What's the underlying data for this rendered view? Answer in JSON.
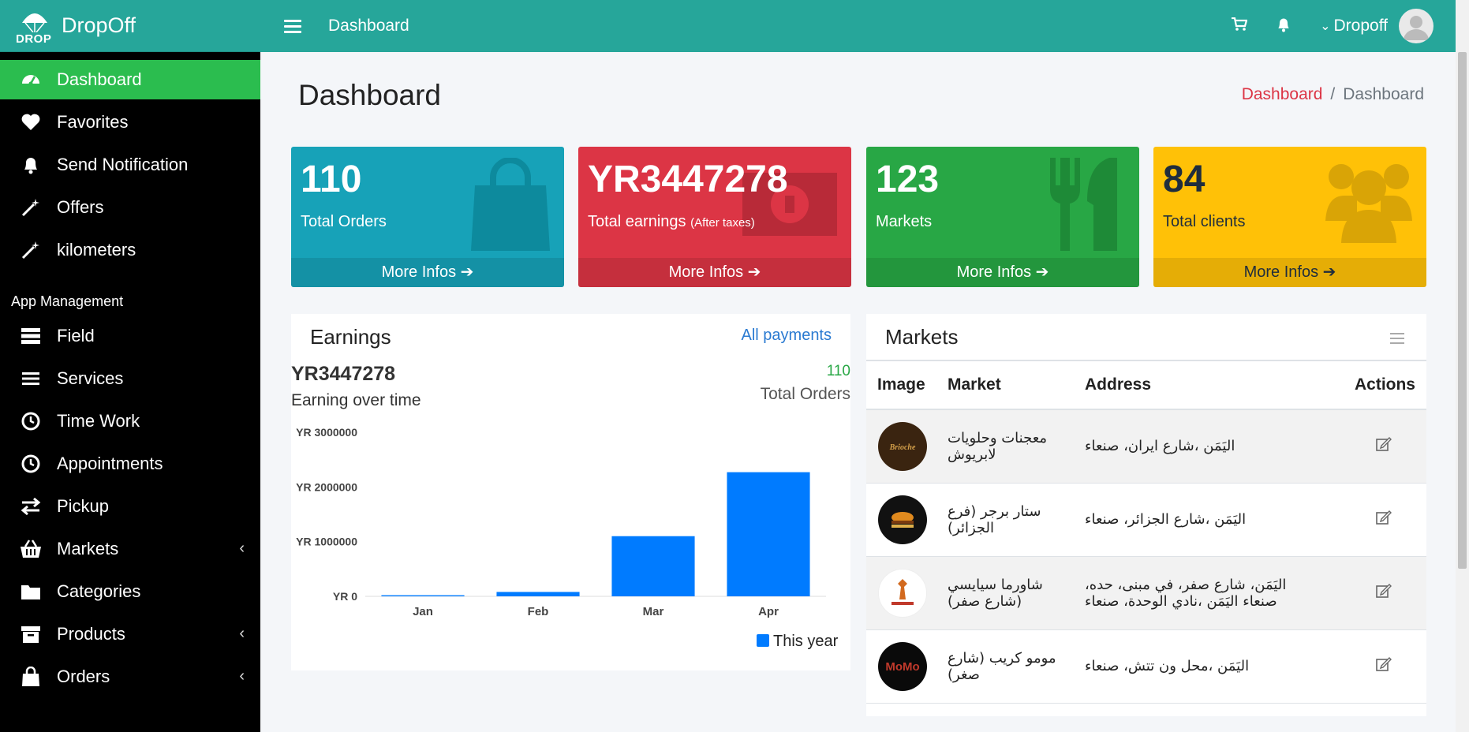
{
  "brand": {
    "name": "DropOff",
    "logo_text": "DROP"
  },
  "topbar": {
    "title": "Dashboard",
    "user": "Dropoff"
  },
  "sidebar": {
    "items": [
      {
        "label": "Dashboard",
        "icon": "tachometer-icon",
        "active": true
      },
      {
        "label": "Favorites",
        "icon": "heart-icon"
      },
      {
        "label": "Send Notification",
        "icon": "bell-icon"
      },
      {
        "label": "Offers",
        "icon": "magic-wand-icon"
      },
      {
        "label": "kilometers",
        "icon": "magic-wand-icon"
      }
    ],
    "section_header": "App Management",
    "management_items": [
      {
        "label": "Field",
        "icon": "server-icon"
      },
      {
        "label": "Services",
        "icon": "list-icon"
      },
      {
        "label": "Time Work",
        "icon": "clock-icon"
      },
      {
        "label": "Appointments",
        "icon": "clock-icon"
      },
      {
        "label": "Pickup",
        "icon": "exchange-icon"
      },
      {
        "label": "Markets",
        "icon": "basket-icon",
        "has_submenu": true
      },
      {
        "label": "Categories",
        "icon": "folder-icon"
      },
      {
        "label": "Products",
        "icon": "archive-icon",
        "has_submenu": true
      },
      {
        "label": "Orders",
        "icon": "shopping-bag-icon",
        "has_submenu": true
      }
    ]
  },
  "page": {
    "title": "Dashboard",
    "breadcrumb": [
      "Dashboard",
      "Dashboard"
    ]
  },
  "cards": [
    {
      "value": "110",
      "label": "Total Orders",
      "note": "",
      "footer": "More Infos",
      "color": "#17a2b8",
      "icon": "shopping-bag-icon"
    },
    {
      "value": "YR3447278",
      "label": "Total earnings",
      "note": "(After taxes)",
      "footer": "More Infos",
      "color": "#dc3545",
      "icon": "money-icon"
    },
    {
      "value": "123",
      "label": "Markets",
      "note": "",
      "footer": "More Infos",
      "color": "#28a745",
      "icon": "cutlery-icon"
    },
    {
      "value": "84",
      "label": "Total clients",
      "note": "",
      "footer": "More Infos",
      "color": "#ffc107",
      "icon": "users-icon"
    }
  ],
  "earnings": {
    "title": "Earnings",
    "link": "All payments",
    "total": "YR3447278",
    "subtitle": "Earning over time",
    "orders_count": "110",
    "orders_label": "Total Orders"
  },
  "chart_data": {
    "type": "bar",
    "categories": [
      "Jan",
      "Feb",
      "Mar",
      "Apr"
    ],
    "series": [
      {
        "name": "This year",
        "values": [
          20000,
          80000,
          1100000,
          2270000
        ],
        "color": "#007bff"
      }
    ],
    "ylim": [
      0,
      3000000
    ],
    "yticks": [
      0,
      1000000,
      2000000,
      3000000
    ],
    "ytick_labels": [
      "YR 0",
      "YR 1000000",
      "YR 2000000",
      "YR 3000000"
    ],
    "legend_position": "bottom-right"
  },
  "markets": {
    "title": "Markets",
    "columns": [
      "Image",
      "Market",
      "Address",
      "Actions"
    ],
    "rows": [
      {
        "name": "معجنات وحلويات لابريوش",
        "address": "اليَمَن ،شارع ايران، صنعاء",
        "logo_color": "#3a2410"
      },
      {
        "name": "ستار برجر (فرع الجزائر)",
        "address": "اليَمَن ،شارع الجزائر، صنعاء",
        "logo_color": "#111111"
      },
      {
        "name": "شاورما سيايسي (شارع صفر)",
        "address": "اليَمَن، شارع صفر، في مبنى، حده، صنعاء اليَمَن ،نادي الوحدة، صنعاء",
        "logo_color": "#ffffff"
      },
      {
        "name": "مومو كريب (شارع صغر)",
        "address": "اليَمَن ،محل ون تتش، صنعاء",
        "logo_color": "#0a0a0a"
      }
    ]
  }
}
